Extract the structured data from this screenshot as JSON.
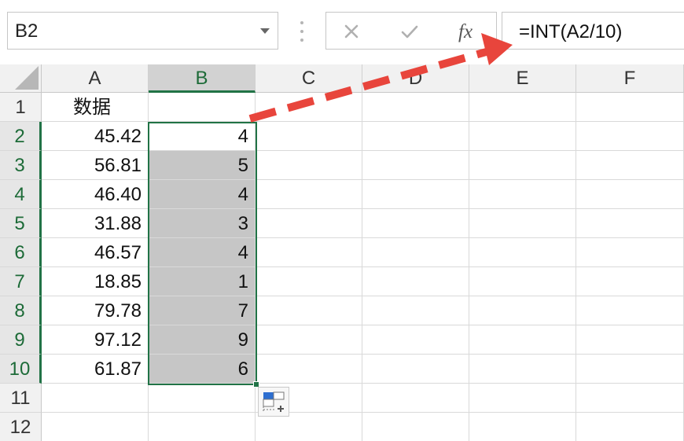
{
  "formula_bar": {
    "name_box": "B2",
    "formula": "=INT(A2/10)",
    "cancel_icon": "close-icon",
    "enter_icon": "check-icon",
    "function_icon": "fx-icon"
  },
  "columns": [
    "A",
    "B",
    "C",
    "D",
    "E",
    "F"
  ],
  "selected_column": "B",
  "rows": [
    {
      "num": "1",
      "a": "数据",
      "b": ""
    },
    {
      "num": "2",
      "a": "45.42",
      "b": "4"
    },
    {
      "num": "3",
      "a": "56.81",
      "b": "5"
    },
    {
      "num": "4",
      "a": "46.40",
      "b": "4"
    },
    {
      "num": "5",
      "a": "31.88",
      "b": "3"
    },
    {
      "num": "6",
      "a": "46.57",
      "b": "4"
    },
    {
      "num": "7",
      "a": "18.85",
      "b": "1"
    },
    {
      "num": "8",
      "a": "79.78",
      "b": "7"
    },
    {
      "num": "9",
      "a": "97.12",
      "b": "9"
    },
    {
      "num": "10",
      "a": "61.87",
      "b": "6"
    },
    {
      "num": "11",
      "a": "",
      "b": ""
    },
    {
      "num": "12",
      "a": "",
      "b": ""
    }
  ],
  "selection": {
    "range": "B2:B10",
    "active_cell": "B2"
  },
  "colors": {
    "selection_green": "#217346",
    "shade_gray": "#c6c6c6",
    "annotation_red": "#e8453c"
  },
  "annotation": {
    "type": "dashed-arrow",
    "from": "selection B2",
    "to": "formula bar",
    "icon": "annotation-arrow-icon"
  },
  "quick_analysis_icon": "quick-analysis-icon"
}
